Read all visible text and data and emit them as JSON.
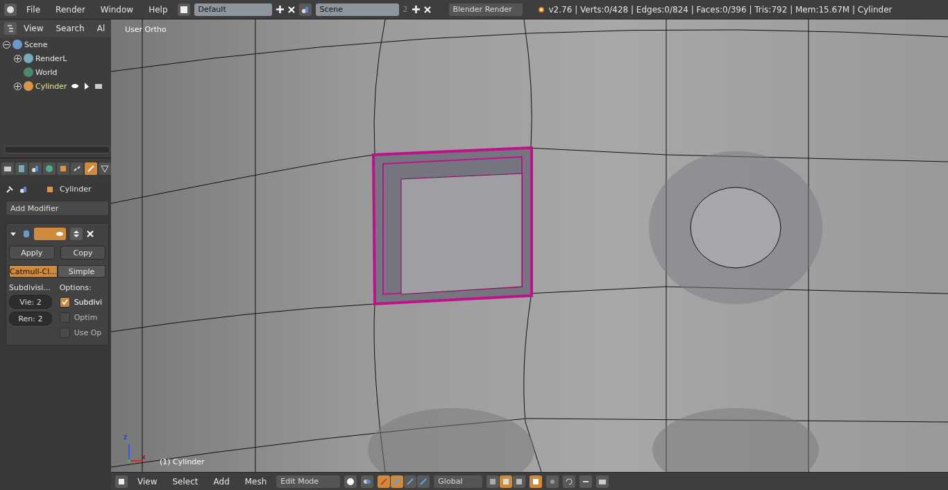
{
  "top_bar": {
    "menus": [
      "File",
      "Render",
      "Window",
      "Help"
    ],
    "layout": "Default",
    "scene": "Scene",
    "scene_users": "2",
    "engine": "Blender Render",
    "stats": "v2.76 | Verts:0/428 | Edges:0/824 | Faces:0/396 | Tris:792 | Mem:15.67M | Cylinder"
  },
  "outliner": {
    "menus": [
      "View",
      "Search",
      "Al"
    ],
    "tree": [
      {
        "label": "Scene",
        "kind": "scene",
        "expanded": true,
        "active": false,
        "children": [
          {
            "label": "RenderL",
            "kind": "layers",
            "expanded": false,
            "active": false
          },
          {
            "label": "World",
            "kind": "world",
            "active": false
          },
          {
            "label": "Cylinder",
            "kind": "object",
            "expanded": false,
            "active": true
          }
        ]
      }
    ]
  },
  "properties": {
    "tabs": [
      {
        "kind": "render",
        "selected": false
      },
      {
        "kind": "layers",
        "selected": false
      },
      {
        "kind": "scene",
        "selected": false
      },
      {
        "kind": "world",
        "selected": false
      },
      {
        "kind": "object",
        "selected": false
      },
      {
        "kind": "constraints",
        "selected": false
      },
      {
        "kind": "modifiers",
        "selected": true
      },
      {
        "kind": "data",
        "selected": false
      }
    ],
    "context": "Cylinder",
    "add_modifier": "Add Modifier",
    "modifier": {
      "buttons": [
        "Apply",
        "Copy"
      ],
      "types": [
        {
          "label": "Catmull-Cl...",
          "selected": true
        },
        {
          "label": "Simple",
          "selected": false
        }
      ],
      "subdiv_label": "Subdivisi...",
      "fields": [
        "Vie: 2",
        "Ren: 2"
      ],
      "options_label": "Options:",
      "options": [
        {
          "label": "Subdivi",
          "checked": true
        },
        {
          "label": "Optim",
          "checked": false
        },
        {
          "label": "Use Op",
          "checked": false
        }
      ]
    }
  },
  "viewport": {
    "view_name": "User Ortho",
    "object_label": "(1) Cylinder",
    "axis_labels": [
      "z",
      "x"
    ]
  },
  "bottom_bar": {
    "menus": [
      "View",
      "Select",
      "Add",
      "Mesh"
    ],
    "mode": "Edit Mode",
    "orientation": "Global",
    "manipulators": [
      {
        "kind": "combo",
        "selected": true
      },
      {
        "kind": "translate",
        "selected": true
      },
      {
        "kind": "rotate",
        "selected": false
      },
      {
        "kind": "scale",
        "selected": false
      }
    ],
    "select_modes": [
      {
        "kind": "vertex",
        "selected": false
      },
      {
        "kind": "edge",
        "selected": true
      },
      {
        "kind": "face",
        "selected": false
      }
    ]
  }
}
